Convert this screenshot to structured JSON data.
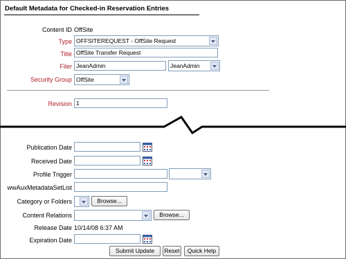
{
  "header": {
    "title": "Default Metadata for Checked-in Reservation Entries"
  },
  "top_fields": {
    "content_id": {
      "label": "Content ID",
      "value": "OffSite"
    },
    "type": {
      "label": "Type",
      "value": "OFFSITEREQUEST - OffSite Request"
    },
    "title": {
      "label": "Title",
      "value": "OffSite Transfer Request"
    },
    "filer": {
      "label": "Filer",
      "value": "JeanAdmin",
      "select_value": "JeanAdmin"
    },
    "security_group": {
      "label": "Security Group",
      "value": "OffSite"
    },
    "revision": {
      "label": "Revision",
      "value": "1"
    }
  },
  "bottom_fields": {
    "publication_date": {
      "label": "Publication Date",
      "value": ""
    },
    "received_date": {
      "label": "Received Date",
      "value": ""
    },
    "profile_trigger": {
      "label": "Profile Trigger",
      "value": "",
      "select_value": ""
    },
    "aux_metadata": {
      "label": "wwAuxMetadataSetList",
      "value": ""
    },
    "category_folders": {
      "label": "Category or Folders",
      "select_value": "",
      "browse_label": "Browse..."
    },
    "content_relations": {
      "label": "Content Relations",
      "select_value": "",
      "browse_label": "Browse..."
    },
    "release_date": {
      "label": "Release Date",
      "value": "10/14/08 6:37 AM"
    },
    "expiration_date": {
      "label": "Expiration Date",
      "value": ""
    }
  },
  "actions": {
    "submit_label": "Submit Update",
    "reset_label": "Reset",
    "help_label": "Quick Help"
  },
  "icons": {
    "calendar": "calendar-icon",
    "break": "break-line-icon"
  },
  "colors": {
    "required_label": "#b0202a",
    "input_border": "#7f9db9"
  }
}
